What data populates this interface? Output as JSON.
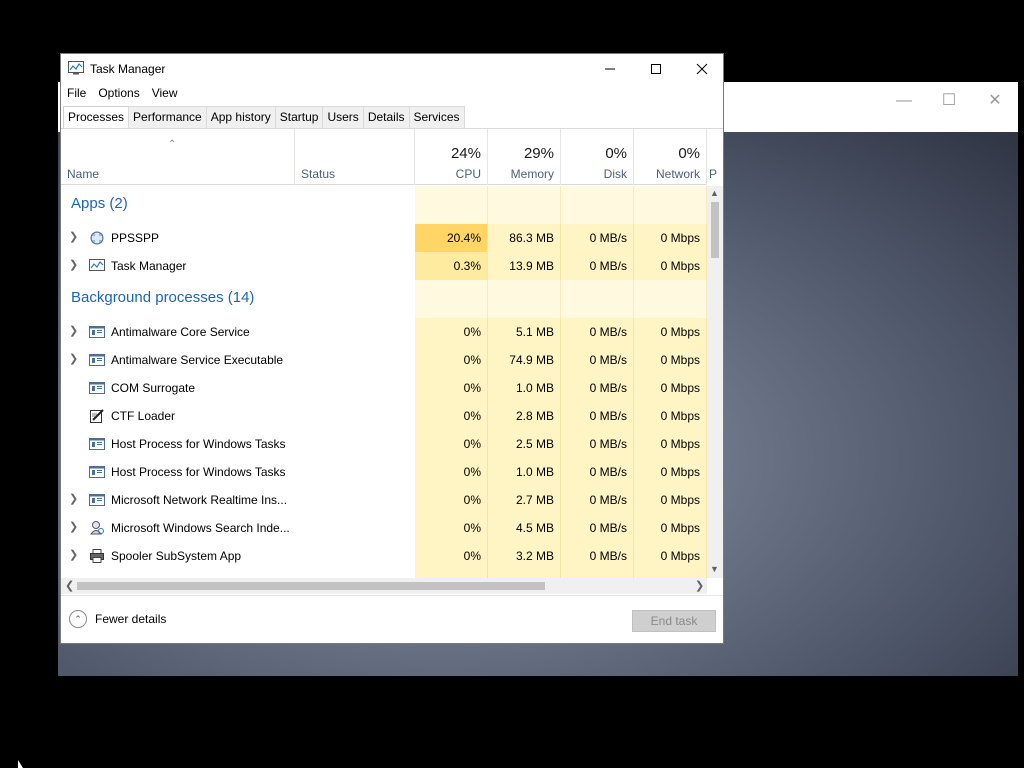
{
  "window": {
    "title": "Task Manager"
  },
  "menu": [
    "File",
    "Options",
    "View"
  ],
  "tabs": [
    "Processes",
    "Performance",
    "App history",
    "Startup",
    "Users",
    "Details",
    "Services"
  ],
  "columns": {
    "name": "Name",
    "status": "Status",
    "cpu": {
      "pct": "24%",
      "label": "CPU"
    },
    "memory": {
      "pct": "29%",
      "label": "Memory"
    },
    "disk": {
      "pct": "0%",
      "label": "Disk"
    },
    "network": {
      "pct": "0%",
      "label": "Network"
    },
    "next_partial": "P"
  },
  "groups": {
    "apps": "Apps (2)",
    "background": "Background processes (14)"
  },
  "apps": [
    {
      "name": "PPSSPP",
      "cpu": "20.4%",
      "mem": "86.3 MB",
      "disk": "0 MB/s",
      "net": "0 Mbps",
      "icon": "ppsspp-icon"
    },
    {
      "name": "Task Manager",
      "cpu": "0.3%",
      "mem": "13.9 MB",
      "disk": "0 MB/s",
      "net": "0 Mbps",
      "icon": "task-manager-icon"
    }
  ],
  "background": [
    {
      "name": "Antimalware Core Service",
      "cpu": "0%",
      "mem": "5.1 MB",
      "disk": "0 MB/s",
      "net": "0 Mbps",
      "icon": "service-icon"
    },
    {
      "name": "Antimalware Service Executable",
      "cpu": "0%",
      "mem": "74.9 MB",
      "disk": "0 MB/s",
      "net": "0 Mbps",
      "icon": "service-icon"
    },
    {
      "name": "COM Surrogate",
      "cpu": "0%",
      "mem": "1.0 MB",
      "disk": "0 MB/s",
      "net": "0 Mbps",
      "icon": "service-icon"
    },
    {
      "name": "CTF Loader",
      "cpu": "0%",
      "mem": "2.8 MB",
      "disk": "0 MB/s",
      "net": "0 Mbps",
      "icon": "pen-icon"
    },
    {
      "name": "Host Process for Windows Tasks",
      "cpu": "0%",
      "mem": "2.5 MB",
      "disk": "0 MB/s",
      "net": "0 Mbps",
      "icon": "service-icon"
    },
    {
      "name": "Host Process for Windows Tasks",
      "cpu": "0%",
      "mem": "1.0 MB",
      "disk": "0 MB/s",
      "net": "0 Mbps",
      "icon": "service-icon"
    },
    {
      "name": "Microsoft Network Realtime Ins...",
      "cpu": "0%",
      "mem": "2.7 MB",
      "disk": "0 MB/s",
      "net": "0 Mbps",
      "icon": "service-icon"
    },
    {
      "name": "Microsoft Windows Search Inde...",
      "cpu": "0%",
      "mem": "4.5 MB",
      "disk": "0 MB/s",
      "net": "0 Mbps",
      "icon": "search-indexer-icon"
    },
    {
      "name": "Spooler SubSystem App",
      "cpu": "0%",
      "mem": "3.2 MB",
      "disk": "0 MB/s",
      "net": "0 Mbps",
      "icon": "printer-icon"
    }
  ],
  "footer": {
    "fewer_details": "Fewer details",
    "end_task": "End task"
  }
}
